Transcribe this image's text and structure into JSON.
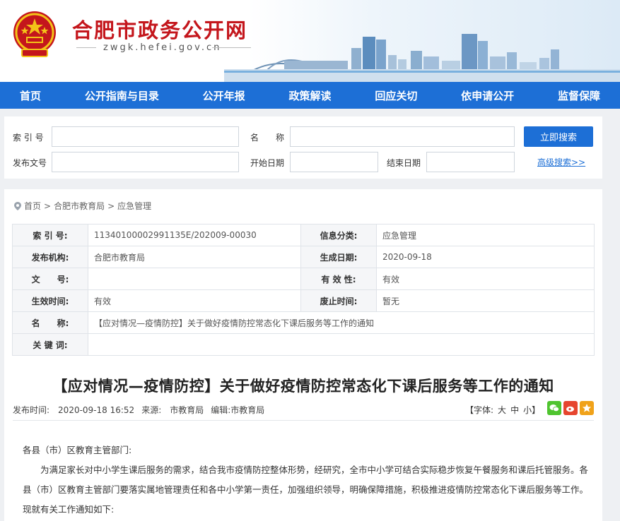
{
  "header": {
    "title": "合肥市政务公开网",
    "url": "zwgk.hefei.gov.cn"
  },
  "nav": [
    "首页",
    "公开指南与目录",
    "公开年报",
    "政策解读",
    "回应关切",
    "依申请公开",
    "监督保障"
  ],
  "search": {
    "index_label": "索 引 号",
    "name_label": "名　　称",
    "doc_no_label": "发布文号",
    "start_label": "开始日期",
    "end_label": "结束日期",
    "button_label": "立即搜索",
    "advanced_label": "高级搜索>>"
  },
  "breadcrumb": [
    "首页",
    ">",
    "合肥市教育局",
    ">",
    "应急管理"
  ],
  "info": {
    "index_key": "索 引 号:",
    "index_val": "11340100002991135E/202009-00030",
    "category_key": "信息分类:",
    "category_val": "应急管理",
    "org_key": "发布机构:",
    "org_val": "合肥市教育局",
    "date_key": "生成日期:",
    "date_val": "2020-09-18",
    "docno_key": "文　　号:",
    "docno_val": "",
    "validity_key": "有 效 性:",
    "validity_val": "有效",
    "effect_key": "生效时间:",
    "effect_val": "有效",
    "expire_key": "废止时间:",
    "expire_val": "暂无",
    "name_key": "名　　称:",
    "name_val": "【应对情况—疫情防控】关于做好疫情防控常态化下课后服务等工作的通知",
    "keywords_key": "关 键 词:",
    "keywords_val": ""
  },
  "document": {
    "title": "【应对情况—疫情防控】关于做好疫情防控常态化下课后服务等工作的通知",
    "publish_time": "发布时间:　2020-09-18 16:52",
    "source": "来源:　市教育局",
    "editor": "编辑:市教育局",
    "font_label": "【字体:",
    "font_large": "大",
    "font_medium": "中",
    "font_small": "小】",
    "salutation": "各县（市）区教育主管部门:",
    "paragraph1": "为满足家长对中小学生课后服务的需求，结合我市疫情防控整体形势，经研究，全市中小学可结合实际稳步恢复午餐服务和课后托管服务。各县（市）区教育主管部门要落实属地管理责任和各中小学第一责任，加强组织领导，明确保障措施，积极推进疫情防控常态化下课后服务等工作。现就有关工作通知如下:"
  },
  "colors": {
    "nav_blue": "#1d6fd6",
    "title_red": "#c4161c",
    "wechat_green": "#4fc42f",
    "weibo_red": "#e6452e",
    "favorite_orange": "#f0a21a"
  }
}
